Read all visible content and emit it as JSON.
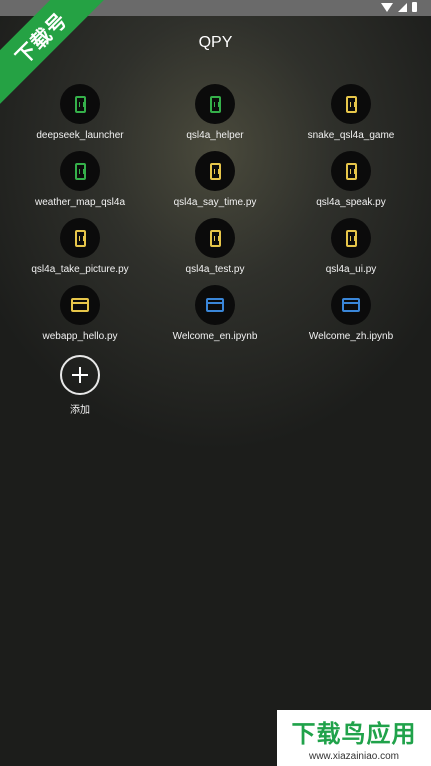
{
  "status_bar": {
    "icons": [
      "wifi-icon",
      "signal-icon",
      "battery-icon"
    ]
  },
  "watermark_top": "下载号",
  "app": {
    "title": "QPY"
  },
  "grid_items": [
    {
      "label": "deepseek_launcher",
      "icon": "phone-icon",
      "color": "#35b04a"
    },
    {
      "label": "qsl4a_helper",
      "icon": "phone-icon",
      "color": "#35b04a"
    },
    {
      "label": "snake_qsl4a_game",
      "icon": "phone-icon",
      "color": "#35b04a"
    },
    {
      "label": "weather_map_qsl4a",
      "icon": "phone-icon",
      "color": "#35b04a"
    },
    {
      "label": "qsl4a_say_time.py",
      "icon": "phone-icon",
      "color": "#e7c64a"
    },
    {
      "label": "qsl4a_speak.py",
      "icon": "phone-icon",
      "color": "#e7c64a"
    },
    {
      "label": "qsl4a_take_picture.py",
      "icon": "phone-icon",
      "color": "#e7c64a"
    },
    {
      "label": "qsl4a_test.py",
      "icon": "phone-icon",
      "color": "#e7c64a"
    },
    {
      "label": "qsl4a_ui.py",
      "icon": "phone-icon",
      "color": "#e7c64a"
    },
    {
      "label": "webapp_hello.py",
      "icon": "window-icon",
      "color": "#e7c64a"
    },
    {
      "label": "Welcome_en.ipynb",
      "icon": "window-icon",
      "color": "#3a86d8"
    },
    {
      "label": "Welcome_zh.ipynb",
      "icon": "window-icon",
      "color": "#3a86d8"
    }
  ],
  "add": {
    "label": "添加"
  },
  "watermark_bottom": {
    "big": "下载鸟应用",
    "small": "www.xiazainiao.com"
  }
}
